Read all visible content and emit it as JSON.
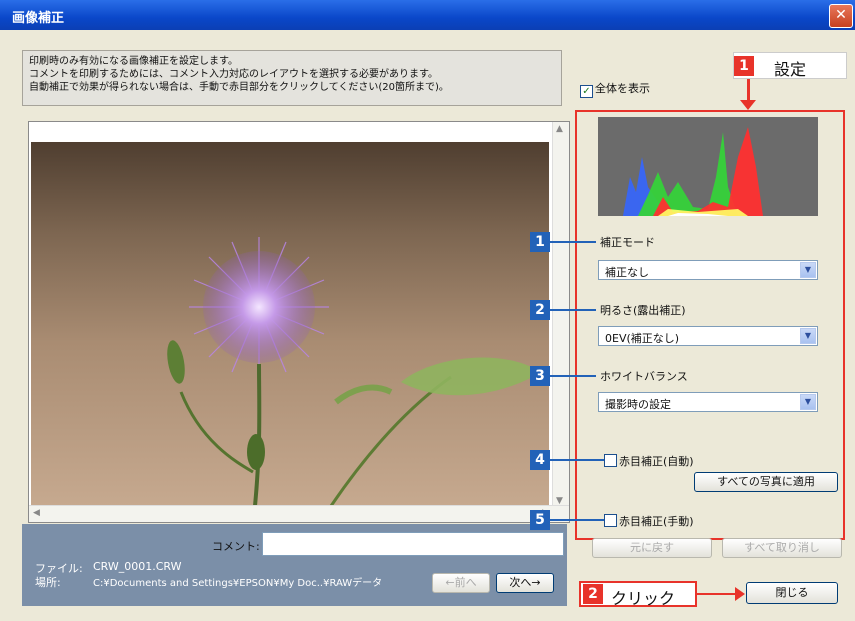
{
  "window": {
    "title": "画像補正",
    "close_symbol": "✕"
  },
  "description": {
    "lines": [
      "印刷時のみ有効になる画像補正を設定します。",
      "コメントを印刷するためには、コメント入力対応のレイアウトを選択する必要があります。",
      "自動補正で効果が得られない場合は、手動で赤目部分をクリックしてください(20箇所まで)。"
    ]
  },
  "show_all": {
    "label": "全体を表示",
    "checked": true
  },
  "annotations": {
    "set_label": "設定",
    "click_label": "クリック",
    "badge_1": "1",
    "badge_2": "2",
    "badge_3": "3",
    "badge_4": "4",
    "badge_5": "5"
  },
  "correction_mode": {
    "label": "補正モード",
    "value": "補正なし"
  },
  "brightness": {
    "label": "明るさ(露出補正)",
    "value": "0EV(補正なし)"
  },
  "white_balance": {
    "label": "ホワイトバランス",
    "value": "撮影時の設定"
  },
  "red_eye_auto": {
    "label": "赤目補正(自動)",
    "checked": false
  },
  "apply_all_label": "すべての写真に適用",
  "red_eye_manual": {
    "label": "赤目補正(手動)",
    "checked": false
  },
  "undo_label": "元に戻す",
  "undo_all_label": "すべて取り消し",
  "comment": {
    "label": "コメント:",
    "value": ""
  },
  "file": {
    "label": "ファイル:",
    "value": "CRW_0001.CRW"
  },
  "location": {
    "label": "場所:",
    "value": "C:¥Documents and Settings¥EPSON¥My Doc..¥RAWデータ"
  },
  "prev_label": "←前へ",
  "next_label": "次へ→",
  "close_label": "閉じる",
  "colors": {
    "accent_red": "#e8332a",
    "badge_blue": "#2262b8",
    "title_blue": "#0a47c9"
  }
}
